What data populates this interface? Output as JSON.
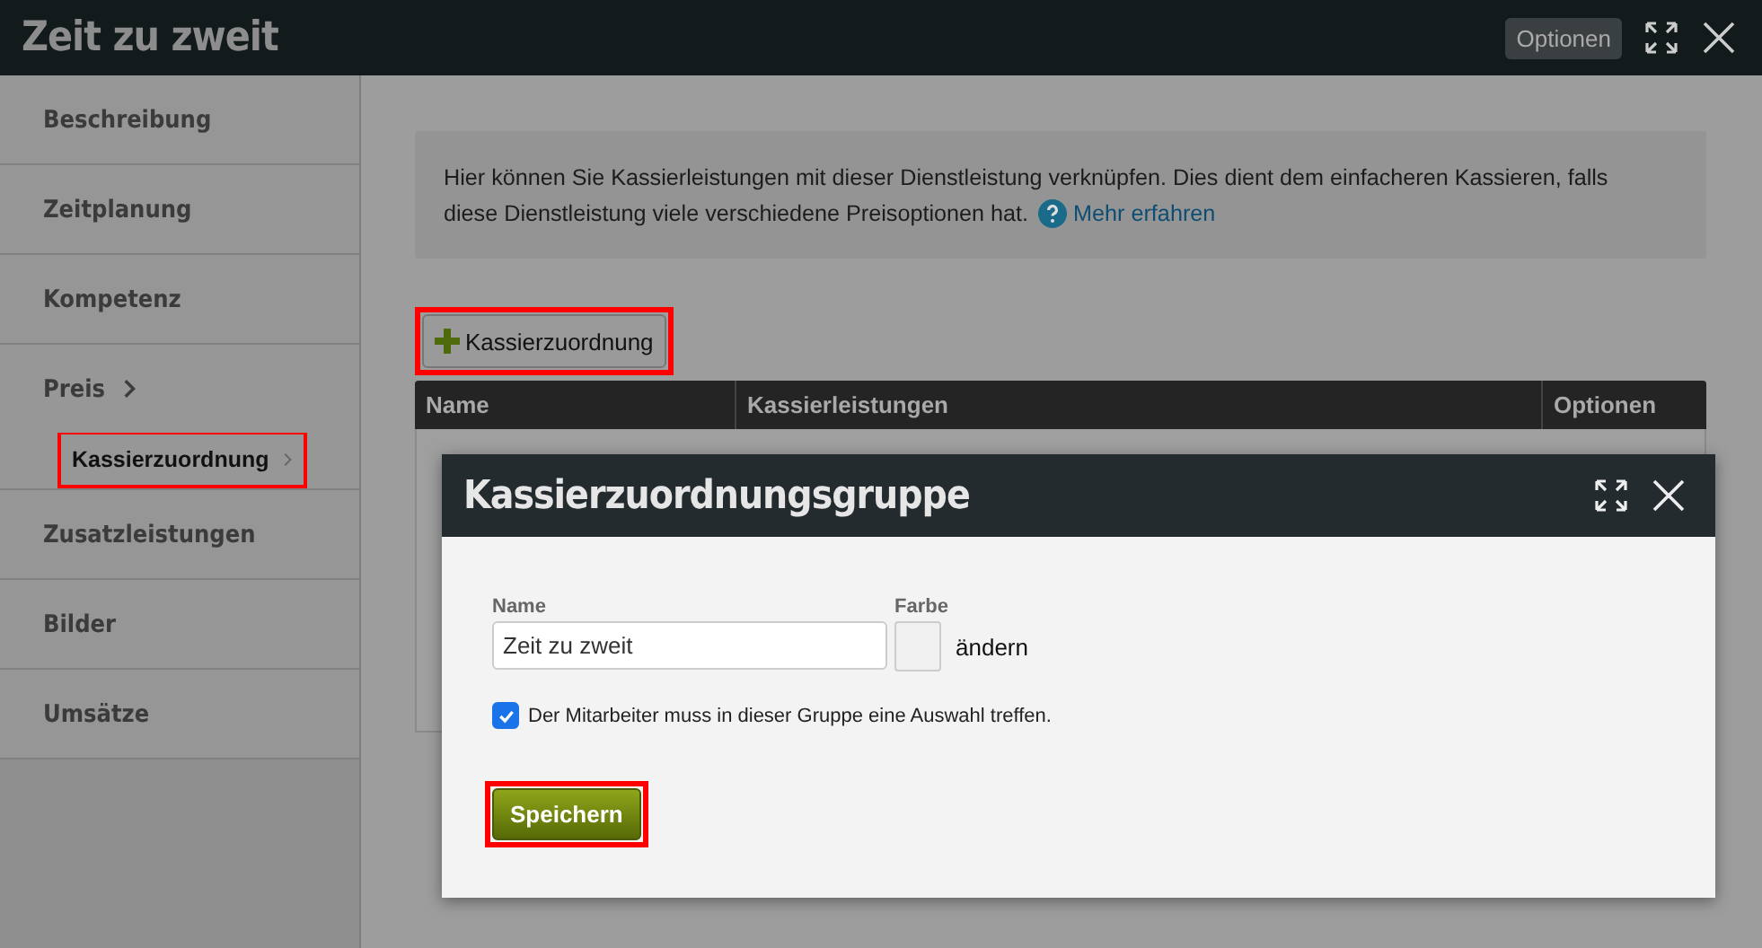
{
  "window": {
    "title": "Zeit zu zweit",
    "options_button": "Optionen"
  },
  "sidebar": {
    "items": [
      {
        "label": "Beschreibung",
        "expanded": false
      },
      {
        "label": "Zeitplanung",
        "expanded": false
      },
      {
        "label": "Kompetenz",
        "expanded": false
      },
      {
        "label": "Preis",
        "expanded": true,
        "children": [
          {
            "label": "Kassierzuordnung",
            "highlighted": true
          }
        ]
      },
      {
        "label": "Zusatzleistungen",
        "expanded": false
      },
      {
        "label": "Bilder",
        "expanded": false
      },
      {
        "label": "Umsätze",
        "expanded": false
      }
    ]
  },
  "info": {
    "lines": [
      "Hier können Sie Kassierleistungen mit dieser Dienstleistung verknüpfen. Dies dient dem einfacheren Kassieren, falls",
      "diese Dienstleistung viele verschiedene Preisoptionen hat."
    ],
    "link": "Mehr erfahren"
  },
  "add_button": {
    "label": "Kassierzuordnung",
    "highlighted": true
  },
  "table": {
    "columns": [
      "Name",
      "Kassierleistungen",
      "Optionen"
    ]
  },
  "dialog": {
    "title": "Kassierzuordnungsgruppe",
    "name_label": "Name",
    "name_value": "Zeit zu zweit",
    "color_label": "Farbe",
    "color_action": "ändern",
    "required": {
      "label": "Der Mitarbeiter muss in dieser Gruppe eine Auswahl treffen.",
      "checked": true
    },
    "save_button": {
      "label": "Speichern",
      "highlighted": true
    }
  }
}
